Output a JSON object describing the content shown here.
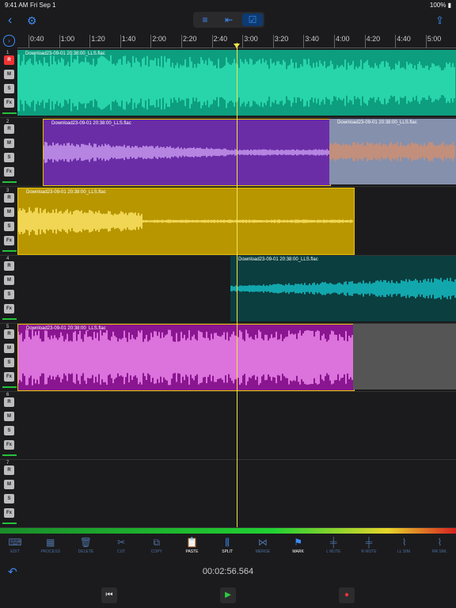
{
  "status": {
    "time": "9:41 AM",
    "date": "Fri Sep 1",
    "battery": "100%"
  },
  "nav": {
    "back_icon": "chevron-left-icon",
    "settings_icon": "gear-icon",
    "share_icon": "share-icon",
    "view_modes": [
      "track-list-icon",
      "indent-icon",
      "checkbox-icon"
    ]
  },
  "ruler": {
    "ticks": [
      "0:40",
      "1:00",
      "1:20",
      "1:40",
      "2:00",
      "2:20",
      "2:40",
      "3:00",
      "3:20",
      "3:40",
      "4:00",
      "4:20",
      "4:40",
      "5:00"
    ]
  },
  "tracks": [
    {
      "num": "1",
      "clips": [
        {
          "name": "Download23-09-01 20:38:00_LLS.flac"
        }
      ]
    },
    {
      "num": "2",
      "clips": [
        {
          "name": "Download23-09-01 20:38:00_LLS.flac"
        },
        {
          "name": "Download23-09-01 20:38:00_LLS.flac"
        }
      ]
    },
    {
      "num": "3",
      "clips": [
        {
          "name": "Download23-09-01 20:38:00_LLS.flac"
        }
      ]
    },
    {
      "num": "4",
      "clips": [
        {
          "name": "Download23-09-01 20:38:00_LLS.flac"
        }
      ]
    },
    {
      "num": "5",
      "clips": [
        {
          "name": "Download23-09-01 20:38:00_LLS.flac"
        }
      ]
    },
    {
      "num": "6",
      "clips": []
    },
    {
      "num": "7",
      "clips": []
    }
  ],
  "track_buttons": {
    "rec": "R",
    "mute": "M",
    "solo": "S",
    "fx": "Fx"
  },
  "toolbar": [
    {
      "label": "EDIT",
      "icon": "edit-icon"
    },
    {
      "label": "PROCESS",
      "icon": "process-icon"
    },
    {
      "label": "DELETE",
      "icon": "trash-icon"
    },
    {
      "label": "CUT",
      "icon": "scissors-icon"
    },
    {
      "label": "COPY",
      "icon": "copy-icon"
    },
    {
      "label": "PASTE",
      "icon": "paste-icon"
    },
    {
      "label": "SPLIT",
      "icon": "split-icon"
    },
    {
      "label": "MERGE",
      "icon": "merge-icon"
    },
    {
      "label": "MARK",
      "icon": "flag-icon"
    },
    {
      "label": "L MUTE",
      "icon": "left-mute-icon"
    },
    {
      "label": "R MUTE",
      "icon": "right-mute-icon"
    },
    {
      "label": "LL SIM.",
      "icon": "ll-sim-icon"
    },
    {
      "label": "RR SIM.",
      "icon": "rr-sim-icon"
    }
  ],
  "timecode": "00:02:56.564",
  "transport": {
    "rewind_icon": "skip-back-icon",
    "play_icon": "play-icon",
    "record_icon": "record-icon"
  },
  "colors": {
    "accent": "#3d8bf5",
    "track1": "#15c9a0",
    "track2": "#6a2da6",
    "track3": "#c9a300",
    "track4": "#0b3e3f",
    "track5": "#a0129c",
    "playhead": "#f2e34a"
  }
}
